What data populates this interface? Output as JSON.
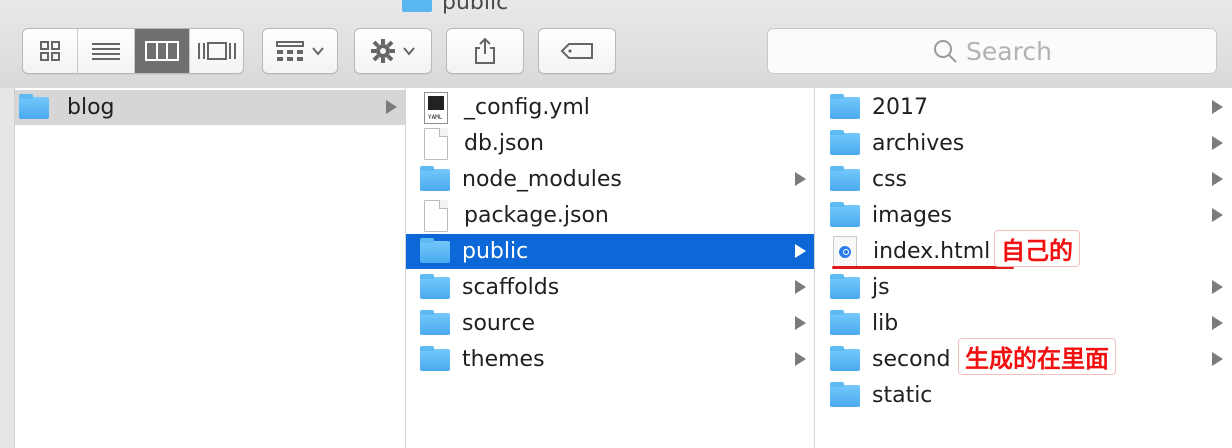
{
  "window": {
    "title": "public"
  },
  "toolbar": {
    "view_modes": [
      "icon-view",
      "list-view",
      "column-view",
      "coverflow-view"
    ],
    "search_placeholder": "Search"
  },
  "columns": [
    {
      "items": [
        {
          "name": "blog",
          "type": "folder",
          "has_arrow": true,
          "selected": "gray"
        }
      ]
    },
    {
      "items": [
        {
          "name": "_config.yml",
          "type": "yaml",
          "has_arrow": false
        },
        {
          "name": "db.json",
          "type": "file",
          "has_arrow": false
        },
        {
          "name": "node_modules",
          "type": "folder",
          "has_arrow": true
        },
        {
          "name": "package.json",
          "type": "file",
          "has_arrow": false
        },
        {
          "name": "public",
          "type": "folder",
          "has_arrow": true,
          "selected": "blue"
        },
        {
          "name": "scaffolds",
          "type": "folder",
          "has_arrow": true
        },
        {
          "name": "source",
          "type": "folder",
          "has_arrow": true
        },
        {
          "name": "themes",
          "type": "folder",
          "has_arrow": true
        }
      ]
    },
    {
      "items": [
        {
          "name": "2017",
          "type": "folder",
          "has_arrow": true
        },
        {
          "name": "archives",
          "type": "folder",
          "has_arrow": true
        },
        {
          "name": "css",
          "type": "folder",
          "has_arrow": true
        },
        {
          "name": "images",
          "type": "folder",
          "has_arrow": true
        },
        {
          "name": "index.html",
          "type": "html",
          "has_arrow": false
        },
        {
          "name": "js",
          "type": "folder",
          "has_arrow": true
        },
        {
          "name": "lib",
          "type": "folder",
          "has_arrow": true
        },
        {
          "name": "second",
          "type": "folder",
          "has_arrow": true
        },
        {
          "name": "static",
          "type": "folder",
          "has_arrow": true
        }
      ]
    }
  ],
  "annotations": {
    "self_made": "自己的",
    "generated_inside": "生成的在里面"
  },
  "colors": {
    "selection": "#0b68d6",
    "folder": "#4aaaf0",
    "annotation": "#f10f0f"
  }
}
